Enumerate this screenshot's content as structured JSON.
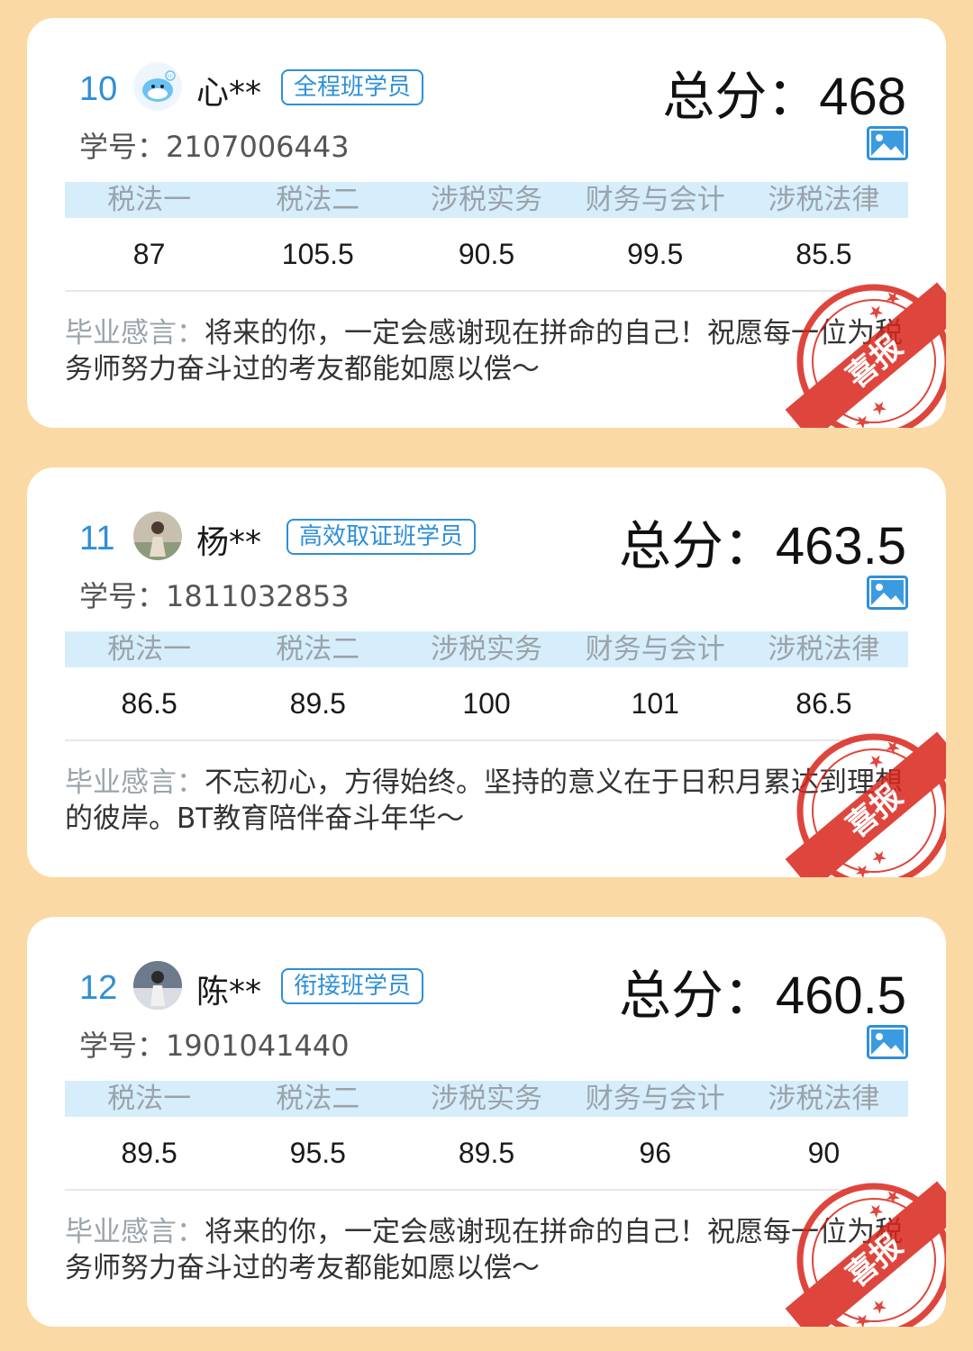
{
  "labels": {
    "total_prefix": "总分：",
    "student_id_prefix": "学号：",
    "message_prefix": "毕业感言：",
    "stamp_text": "喜报"
  },
  "subjects": [
    "税法一",
    "税法二",
    "涉税实务",
    "财务与会计",
    "涉税法律"
  ],
  "colors": {
    "background": "#fbd9a4",
    "accent": "#2f8fd8",
    "subject_header_bg": "#d6eefb",
    "stamp": "#d9261c"
  },
  "students": [
    {
      "rank": "10",
      "name": "心**",
      "badge": "全程班学员",
      "total": "468",
      "student_id": "2107006443",
      "scores": [
        "87",
        "105.5",
        "90.5",
        "99.5",
        "85.5"
      ],
      "message": "将来的你，一定会感谢现在拼命的自己！祝愿每一位为税务师努力奋斗过的考友都能如愿以偿～",
      "avatar": "dolphin-avatar"
    },
    {
      "rank": "11",
      "name": "杨**",
      "badge": "高效取证班学员",
      "total": "463.5",
      "student_id": "1811032853",
      "scores": [
        "86.5",
        "89.5",
        "100",
        "101",
        "86.5"
      ],
      "message": "不忘初心，方得始终。坚持的意义在于日积月累达到理想的彼岸。BT教育陪伴奋斗年华～",
      "avatar": "photo-avatar"
    },
    {
      "rank": "12",
      "name": "陈**",
      "badge": "衔接班学员",
      "total": "460.5",
      "student_id": "1901041440",
      "scores": [
        "89.5",
        "95.5",
        "89.5",
        "96",
        "90"
      ],
      "message": "将来的你，一定会感谢现在拼命的自己！祝愿每一位为税务师努力奋斗过的考友都能如愿以偿～",
      "avatar": "photo-avatar"
    }
  ]
}
